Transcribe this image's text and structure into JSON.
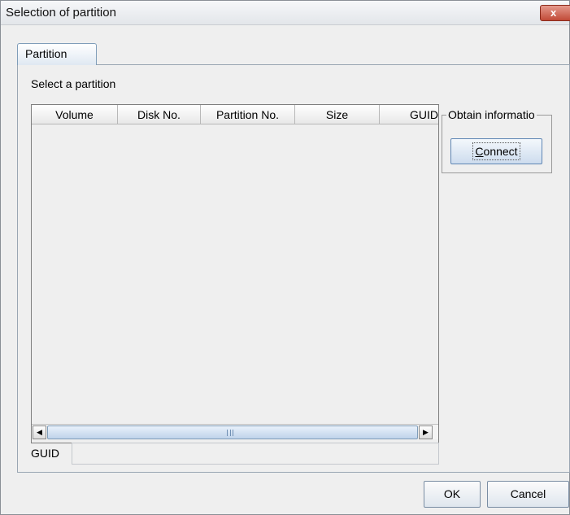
{
  "window": {
    "title": "Selection of  partition",
    "close_glyph": "x"
  },
  "tabs": [
    {
      "label": "Partition",
      "selected": true
    }
  ],
  "partition_panel": {
    "select_label": "Select a partition",
    "table": {
      "columns": [
        "Volume",
        "Disk No.",
        "Partition No.",
        "Size",
        "GUID"
      ],
      "rows": []
    },
    "guid": {
      "label": "GUID",
      "value": ""
    },
    "obtain_group": {
      "legend": "Obtain informatio",
      "connect_label": "Connect",
      "connect_mnemonic": "C"
    }
  },
  "footer": {
    "ok_label": "OK",
    "cancel_label": "Cancel"
  },
  "colors": {
    "dialog_background": "#efefef",
    "close_button": "#c14a37",
    "accent_border": "#7f9db9"
  }
}
